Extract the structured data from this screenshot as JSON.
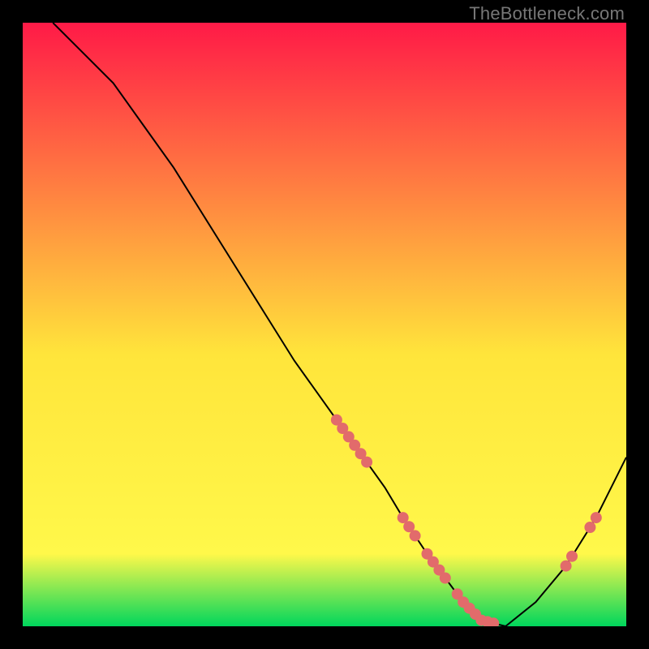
{
  "watermark": "TheBottleneck.com",
  "chart_data": {
    "type": "line",
    "title": "",
    "xlabel": "",
    "ylabel": "",
    "xlim": [
      0,
      100
    ],
    "ylim": [
      0,
      100
    ],
    "background_gradient": {
      "top": "#ff1a47",
      "mid": "#ffe53b",
      "bottom": "#00d65c"
    },
    "curve": {
      "description": "bottleneck V-curve",
      "x": [
        5,
        10,
        15,
        20,
        25,
        30,
        35,
        40,
        45,
        50,
        55,
        60,
        63,
        67,
        70,
        73,
        76,
        80,
        85,
        90,
        95,
        100
      ],
      "y": [
        100,
        95,
        90,
        83,
        76,
        68,
        60,
        52,
        44,
        37,
        30,
        23,
        18,
        12,
        8,
        4,
        1,
        0,
        4,
        10,
        18,
        28
      ]
    },
    "points_on_curve_x": [
      52,
      53,
      54,
      55,
      56,
      57,
      63,
      64,
      65,
      67,
      68,
      69,
      70,
      72,
      73,
      74,
      75,
      76,
      77,
      78,
      90,
      91,
      94,
      95
    ],
    "point_color": "#e26b6b",
    "point_radius": 7,
    "line_color": "#000000",
    "line_width": 2
  }
}
